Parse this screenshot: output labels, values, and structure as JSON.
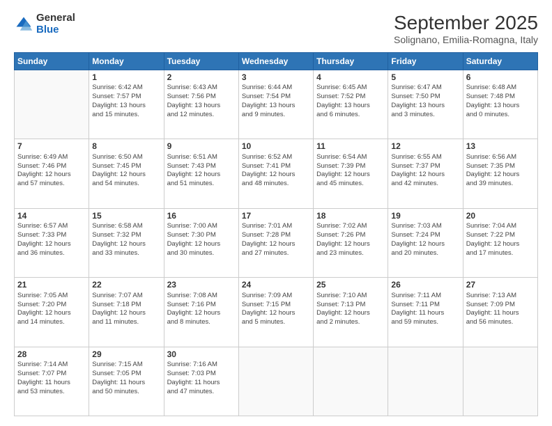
{
  "logo": {
    "general": "General",
    "blue": "Blue"
  },
  "title": "September 2025",
  "subtitle": "Solignano, Emilia-Romagna, Italy",
  "headers": [
    "Sunday",
    "Monday",
    "Tuesday",
    "Wednesday",
    "Thursday",
    "Friday",
    "Saturday"
  ],
  "weeks": [
    [
      {
        "day": "",
        "info": ""
      },
      {
        "day": "1",
        "info": "Sunrise: 6:42 AM\nSunset: 7:57 PM\nDaylight: 13 hours\nand 15 minutes."
      },
      {
        "day": "2",
        "info": "Sunrise: 6:43 AM\nSunset: 7:56 PM\nDaylight: 13 hours\nand 12 minutes."
      },
      {
        "day": "3",
        "info": "Sunrise: 6:44 AM\nSunset: 7:54 PM\nDaylight: 13 hours\nand 9 minutes."
      },
      {
        "day": "4",
        "info": "Sunrise: 6:45 AM\nSunset: 7:52 PM\nDaylight: 13 hours\nand 6 minutes."
      },
      {
        "day": "5",
        "info": "Sunrise: 6:47 AM\nSunset: 7:50 PM\nDaylight: 13 hours\nand 3 minutes."
      },
      {
        "day": "6",
        "info": "Sunrise: 6:48 AM\nSunset: 7:48 PM\nDaylight: 13 hours\nand 0 minutes."
      }
    ],
    [
      {
        "day": "7",
        "info": "Sunrise: 6:49 AM\nSunset: 7:46 PM\nDaylight: 12 hours\nand 57 minutes."
      },
      {
        "day": "8",
        "info": "Sunrise: 6:50 AM\nSunset: 7:45 PM\nDaylight: 12 hours\nand 54 minutes."
      },
      {
        "day": "9",
        "info": "Sunrise: 6:51 AM\nSunset: 7:43 PM\nDaylight: 12 hours\nand 51 minutes."
      },
      {
        "day": "10",
        "info": "Sunrise: 6:52 AM\nSunset: 7:41 PM\nDaylight: 12 hours\nand 48 minutes."
      },
      {
        "day": "11",
        "info": "Sunrise: 6:54 AM\nSunset: 7:39 PM\nDaylight: 12 hours\nand 45 minutes."
      },
      {
        "day": "12",
        "info": "Sunrise: 6:55 AM\nSunset: 7:37 PM\nDaylight: 12 hours\nand 42 minutes."
      },
      {
        "day": "13",
        "info": "Sunrise: 6:56 AM\nSunset: 7:35 PM\nDaylight: 12 hours\nand 39 minutes."
      }
    ],
    [
      {
        "day": "14",
        "info": "Sunrise: 6:57 AM\nSunset: 7:33 PM\nDaylight: 12 hours\nand 36 minutes."
      },
      {
        "day": "15",
        "info": "Sunrise: 6:58 AM\nSunset: 7:32 PM\nDaylight: 12 hours\nand 33 minutes."
      },
      {
        "day": "16",
        "info": "Sunrise: 7:00 AM\nSunset: 7:30 PM\nDaylight: 12 hours\nand 30 minutes."
      },
      {
        "day": "17",
        "info": "Sunrise: 7:01 AM\nSunset: 7:28 PM\nDaylight: 12 hours\nand 27 minutes."
      },
      {
        "day": "18",
        "info": "Sunrise: 7:02 AM\nSunset: 7:26 PM\nDaylight: 12 hours\nand 23 minutes."
      },
      {
        "day": "19",
        "info": "Sunrise: 7:03 AM\nSunset: 7:24 PM\nDaylight: 12 hours\nand 20 minutes."
      },
      {
        "day": "20",
        "info": "Sunrise: 7:04 AM\nSunset: 7:22 PM\nDaylight: 12 hours\nand 17 minutes."
      }
    ],
    [
      {
        "day": "21",
        "info": "Sunrise: 7:05 AM\nSunset: 7:20 PM\nDaylight: 12 hours\nand 14 minutes."
      },
      {
        "day": "22",
        "info": "Sunrise: 7:07 AM\nSunset: 7:18 PM\nDaylight: 12 hours\nand 11 minutes."
      },
      {
        "day": "23",
        "info": "Sunrise: 7:08 AM\nSunset: 7:16 PM\nDaylight: 12 hours\nand 8 minutes."
      },
      {
        "day": "24",
        "info": "Sunrise: 7:09 AM\nSunset: 7:15 PM\nDaylight: 12 hours\nand 5 minutes."
      },
      {
        "day": "25",
        "info": "Sunrise: 7:10 AM\nSunset: 7:13 PM\nDaylight: 12 hours\nand 2 minutes."
      },
      {
        "day": "26",
        "info": "Sunrise: 7:11 AM\nSunset: 7:11 PM\nDaylight: 11 hours\nand 59 minutes."
      },
      {
        "day": "27",
        "info": "Sunrise: 7:13 AM\nSunset: 7:09 PM\nDaylight: 11 hours\nand 56 minutes."
      }
    ],
    [
      {
        "day": "28",
        "info": "Sunrise: 7:14 AM\nSunset: 7:07 PM\nDaylight: 11 hours\nand 53 minutes."
      },
      {
        "day": "29",
        "info": "Sunrise: 7:15 AM\nSunset: 7:05 PM\nDaylight: 11 hours\nand 50 minutes."
      },
      {
        "day": "30",
        "info": "Sunrise: 7:16 AM\nSunset: 7:03 PM\nDaylight: 11 hours\nand 47 minutes."
      },
      {
        "day": "",
        "info": ""
      },
      {
        "day": "",
        "info": ""
      },
      {
        "day": "",
        "info": ""
      },
      {
        "day": "",
        "info": ""
      }
    ]
  ]
}
